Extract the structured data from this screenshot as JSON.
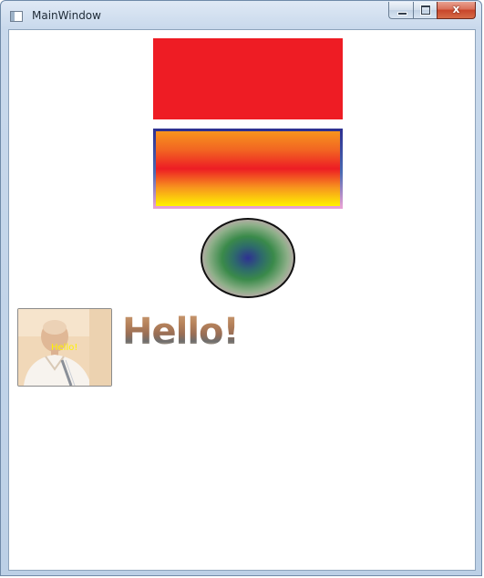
{
  "window": {
    "title": "MainWindow",
    "icon": "window-app-icon",
    "caption_buttons": {
      "minimize_icon": "minimize-icon",
      "maximize_icon": "maximize-icon",
      "close_icon": "close-icon",
      "close_glyph": "x"
    }
  },
  "content": {
    "solid_rectangle": {
      "fill": "#ee1c24"
    },
    "gradient_rectangle": {
      "fill_stops": [
        "#f7941d",
        "#f26522",
        "#ed1c24",
        "#f7931e",
        "#fff200"
      ],
      "stroke_stops": [
        "#2e3192",
        "#4a6bb3",
        "#e7a0d4"
      ]
    },
    "radial_ellipse": {
      "fill_stops": [
        "#2e3192",
        "#2e6b6b",
        "#3a8a4a",
        "#8fb08a",
        "#e8a3cc"
      ],
      "stroke": "#111111"
    },
    "image_button": {
      "label": "Hello!",
      "label_color": "#fff200"
    },
    "image_text": {
      "text": "Hello!"
    }
  }
}
